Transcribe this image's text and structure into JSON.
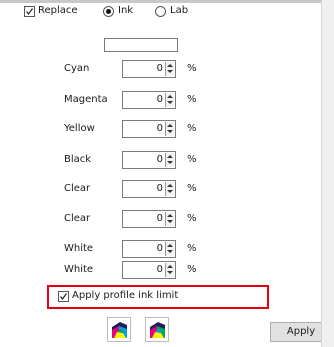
{
  "replace": {
    "label": "Replace",
    "checked": true
  },
  "mode": {
    "options": [
      {
        "label": "Ink",
        "selected": true
      },
      {
        "label": "Lab",
        "selected": false
      }
    ]
  },
  "name_field": {
    "value": ""
  },
  "inks": [
    {
      "label": "Cyan",
      "value": "0"
    },
    {
      "label": "Magenta",
      "value": "0"
    },
    {
      "label": "Yellow",
      "value": "0"
    },
    {
      "label": "Black",
      "value": "0"
    },
    {
      "label": "Clear",
      "value": "0"
    },
    {
      "label": "Clear",
      "value": "0"
    },
    {
      "label": "White",
      "value": "0"
    },
    {
      "label": "White",
      "value": "0"
    }
  ],
  "percent_symbol": "%",
  "profile_limit": {
    "label": "Apply profile ink limit",
    "checked": true
  },
  "icons": [
    "profile-color-icon",
    "profile-color-green-icon"
  ],
  "apply_button": {
    "label": "Apply"
  },
  "colors": {
    "highlight": "#e60012"
  }
}
